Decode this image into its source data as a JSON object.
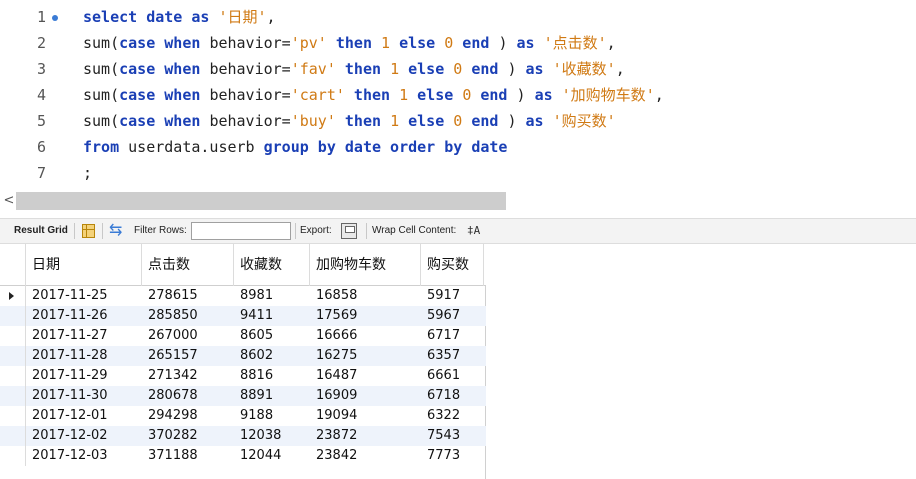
{
  "editor": {
    "lines": [
      {
        "no": "1",
        "tokens": [
          [
            "kw",
            "select date as "
          ],
          [
            "str",
            "'日期'"
          ],
          [
            "plain",
            ","
          ]
        ]
      },
      {
        "no": "2",
        "tokens": [
          [
            "plain",
            "sum("
          ],
          [
            "kw",
            "case when "
          ],
          [
            "plain",
            "behavior="
          ],
          [
            "str",
            "'pv'"
          ],
          [
            "kw",
            " then "
          ],
          [
            "num",
            "1"
          ],
          [
            "kw",
            " else "
          ],
          [
            "num",
            "0"
          ],
          [
            "kw",
            " end "
          ],
          [
            "plain",
            ") "
          ],
          [
            "kw",
            "as "
          ],
          [
            "str",
            "'点击数'"
          ],
          [
            "plain",
            ","
          ]
        ]
      },
      {
        "no": "3",
        "tokens": [
          [
            "plain",
            "sum("
          ],
          [
            "kw",
            "case when "
          ],
          [
            "plain",
            "behavior="
          ],
          [
            "str",
            "'fav'"
          ],
          [
            "kw",
            " then "
          ],
          [
            "num",
            "1"
          ],
          [
            "kw",
            " else "
          ],
          [
            "num",
            "0"
          ],
          [
            "kw",
            " end "
          ],
          [
            "plain",
            ") "
          ],
          [
            "kw",
            "as "
          ],
          [
            "str",
            "'收藏数'"
          ],
          [
            "plain",
            ","
          ]
        ]
      },
      {
        "no": "4",
        "tokens": [
          [
            "plain",
            "sum("
          ],
          [
            "kw",
            "case when "
          ],
          [
            "plain",
            "behavior="
          ],
          [
            "str",
            "'cart'"
          ],
          [
            "kw",
            " then "
          ],
          [
            "num",
            "1"
          ],
          [
            "kw",
            " else "
          ],
          [
            "num",
            "0"
          ],
          [
            "kw",
            " end "
          ],
          [
            "plain",
            ") "
          ],
          [
            "kw",
            "as "
          ],
          [
            "str",
            "'加购物车数'"
          ],
          [
            "plain",
            ","
          ]
        ]
      },
      {
        "no": "5",
        "tokens": [
          [
            "plain",
            "sum("
          ],
          [
            "kw",
            "case when "
          ],
          [
            "plain",
            "behavior="
          ],
          [
            "str",
            "'buy'"
          ],
          [
            "kw",
            " then "
          ],
          [
            "num",
            "1"
          ],
          [
            "kw",
            " else "
          ],
          [
            "num",
            "0"
          ],
          [
            "kw",
            " end "
          ],
          [
            "plain",
            ") "
          ],
          [
            "kw",
            "as "
          ],
          [
            "str",
            "'购买数'"
          ]
        ]
      },
      {
        "no": "6",
        "tokens": [
          [
            "kw",
            "from "
          ],
          [
            "plain",
            "userdata.userb "
          ],
          [
            "kw",
            "group by date order by date"
          ]
        ]
      },
      {
        "no": "7",
        "tokens": [
          [
            "plain",
            ";"
          ]
        ]
      }
    ]
  },
  "toolbar": {
    "result_grid_label": "Result Grid",
    "filter_label": "Filter Rows:",
    "filter_value": "",
    "export_label": "Export:",
    "wrap_label": "Wrap Cell Content:",
    "wrap_icon": "‡A"
  },
  "grid": {
    "columns": [
      "日期",
      "点击数",
      "收藏数",
      "加购物车数",
      "购买数"
    ],
    "rows": [
      [
        "2017-11-25",
        "278615",
        "8981",
        "16858",
        "5917"
      ],
      [
        "2017-11-26",
        "285850",
        "9411",
        "17569",
        "5967"
      ],
      [
        "2017-11-27",
        "267000",
        "8605",
        "16666",
        "6717"
      ],
      [
        "2017-11-28",
        "265157",
        "8602",
        "16275",
        "6357"
      ],
      [
        "2017-11-29",
        "271342",
        "8816",
        "16487",
        "6661"
      ],
      [
        "2017-11-30",
        "280678",
        "8891",
        "16909",
        "6718"
      ],
      [
        "2017-12-01",
        "294298",
        "9188",
        "19094",
        "6322"
      ],
      [
        "2017-12-02",
        "370282",
        "12038",
        "23872",
        "7543"
      ],
      [
        "2017-12-03",
        "371188",
        "12044",
        "23842",
        "7773"
      ]
    ]
  },
  "colors": {
    "keyword": "#1a3fb5",
    "string": "#d07a14",
    "row_alt": "#eef3fb"
  }
}
